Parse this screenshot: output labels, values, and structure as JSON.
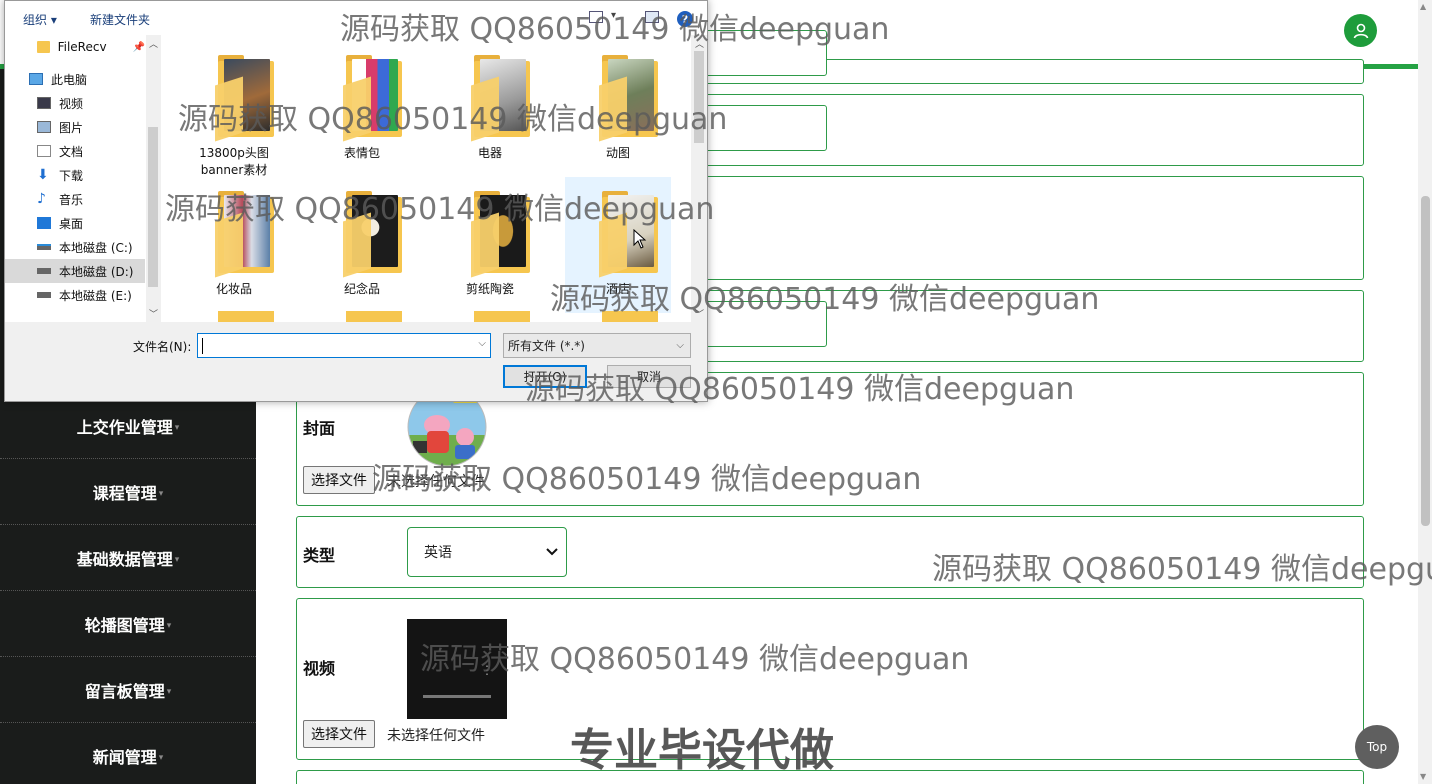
{
  "header": {
    "avatar_icon": "user-icon",
    "accent_color": "#25a244"
  },
  "sidebar": {
    "items": [
      {
        "label": "上交作业管理"
      },
      {
        "label": "课程管理"
      },
      {
        "label": "基础数据管理"
      },
      {
        "label": "轮播图管理"
      },
      {
        "label": "留言板管理"
      },
      {
        "label": "新闻管理"
      }
    ],
    "caret": "▾"
  },
  "form": {
    "cover": {
      "label": "封面",
      "button": "选择文件",
      "status": "未选择任何文件"
    },
    "type": {
      "label": "类型",
      "value": "英语",
      "chevron": "⌄"
    },
    "video": {
      "label": "视频",
      "button": "选择文件",
      "status": "未选择任何文件"
    }
  },
  "top_button": "Top",
  "dialog": {
    "toolbar": {
      "organize": "组织 ▾",
      "new_folder": "新建文件夹",
      "help": "?"
    },
    "nav": [
      {
        "label": "FileRecv",
        "icon": "folder-icon"
      },
      {
        "label": "此电脑",
        "icon": "computer-icon"
      },
      {
        "label": "视频",
        "icon": "video-icon"
      },
      {
        "label": "图片",
        "icon": "pictures-icon"
      },
      {
        "label": "文档",
        "icon": "documents-icon"
      },
      {
        "label": "下载",
        "icon": "download-icon"
      },
      {
        "label": "音乐",
        "icon": "music-icon"
      },
      {
        "label": "桌面",
        "icon": "desktop-icon"
      },
      {
        "label": "本地磁盘 (C:)",
        "icon": "drive-icon"
      },
      {
        "label": "本地磁盘 (D:)",
        "icon": "drive-icon",
        "selected": true
      },
      {
        "label": "本地磁盘 (E:)",
        "icon": "drive-icon"
      }
    ],
    "files": [
      {
        "name": "13800p头图banner素材"
      },
      {
        "name": "表情包"
      },
      {
        "name": "电器"
      },
      {
        "name": "动图"
      },
      {
        "name": "化妆品"
      },
      {
        "name": "纪念品"
      },
      {
        "name": "剪纸陶瓷"
      },
      {
        "name": "酒店"
      }
    ],
    "filename_label": "文件名(N):",
    "filename_value": "",
    "filter": "所有文件 (*.*)",
    "open_button": "打开(O)",
    "cancel_button": "取消"
  },
  "watermarks": [
    "源码获取 QQ86050149 微信deepguan",
    "源码获取 QQ86050149 微信deepguan",
    "源码获取 QQ86050149 微信deepguan",
    "源码获取 QQ86050149 微信deepguan",
    "源码获取 QQ86050149 微信deepguan",
    "源码获取 QQ86050149 微信deepguan",
    "源码获取 QQ86050149 微信deepgu",
    "源码获取 QQ86050149 微信deepguan"
  ],
  "watermark_big": "专业毕设代做"
}
